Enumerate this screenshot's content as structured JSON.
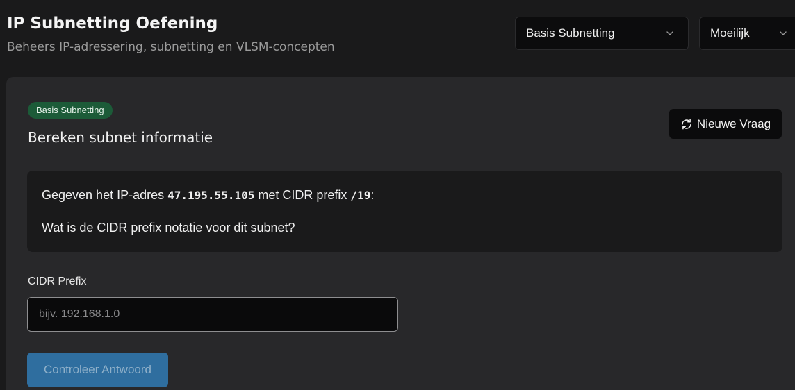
{
  "header": {
    "title": "IP Subnetting Oefening",
    "subtitle": "Beheers IP-adressering, subnetting en VLSM-concepten"
  },
  "controls": {
    "topic_select": {
      "value": "Basis Subnetting",
      "icon": "chevron-down-icon"
    },
    "difficulty_select": {
      "value": "Moeilijk",
      "icon": "chevron-down-icon"
    }
  },
  "question": {
    "badge": "Basis Subnetting",
    "title": "Bereken subnet informatie",
    "new_question_label": "Nieuwe Vraag",
    "new_question_icon": "refresh-icon",
    "line1_prefix": "Gegeven het IP-adres",
    "ip_address": "47.195.55.105",
    "line1_middle": "met CIDR prefix",
    "cidr": "/19",
    "line1_suffix": ":",
    "line2": "Wat is de CIDR prefix notatie voor dit subnet?"
  },
  "answer": {
    "label": "CIDR Prefix",
    "placeholder": "bijv. 192.168.1.0",
    "value": "",
    "submit_label": "Controleer Antwoord"
  },
  "colors": {
    "background": "#1a1a1b",
    "card": "#28282a",
    "badge_bg": "#1c5b38",
    "primary_button": "#2f6e9f"
  }
}
